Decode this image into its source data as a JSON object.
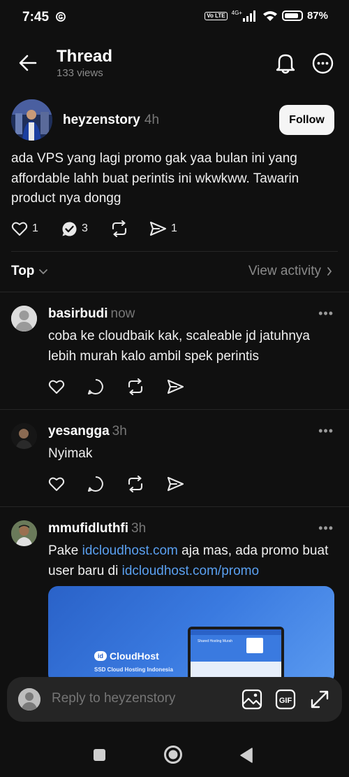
{
  "status_bar": {
    "time": "7:45",
    "network": "4G+",
    "volte": "Vo LTE",
    "battery": "87%"
  },
  "header": {
    "title": "Thread",
    "views": "133 views"
  },
  "post": {
    "author": "heyzenstory",
    "time": "4h",
    "follow_label": "Follow",
    "text": "ada VPS yang lagi promo gak yaa bulan ini yang affordable lahh buat perintis ini wkwkww. Tawarin product nya dongg",
    "likes": "1",
    "replies": "3",
    "shares": "1"
  },
  "sort": {
    "label": "Top",
    "view_activity": "View activity"
  },
  "replies": [
    {
      "author": "basirbudi",
      "time": "now",
      "text": "coba ke cloudbaik kak, scaleable jd jatuhnya lebih murah kalo ambil spek perintis",
      "more": "•••"
    },
    {
      "author": "yesangga",
      "time": "3h",
      "text": "Nyimak",
      "more": "•••"
    },
    {
      "author": "mmufidluthfi",
      "time": "3h",
      "text_prefix": "Pake ",
      "link1": "idcloudhost.com",
      "text_mid": " aja mas, ada promo buat user baru di ",
      "link2": "idcloudhost.com/promo",
      "more": "•••",
      "preview": {
        "brand": "CloudHost",
        "brand_badge": "id",
        "tagline": "SSD Cloud Hosting Indonesia",
        "screen_heading": "Shared Hosting Murah"
      }
    }
  ],
  "composer": {
    "placeholder": "Reply to heyzenstory"
  },
  "colors": {
    "background": "#101010",
    "link": "#5aa0f0",
    "muted": "#8a8a8a"
  }
}
